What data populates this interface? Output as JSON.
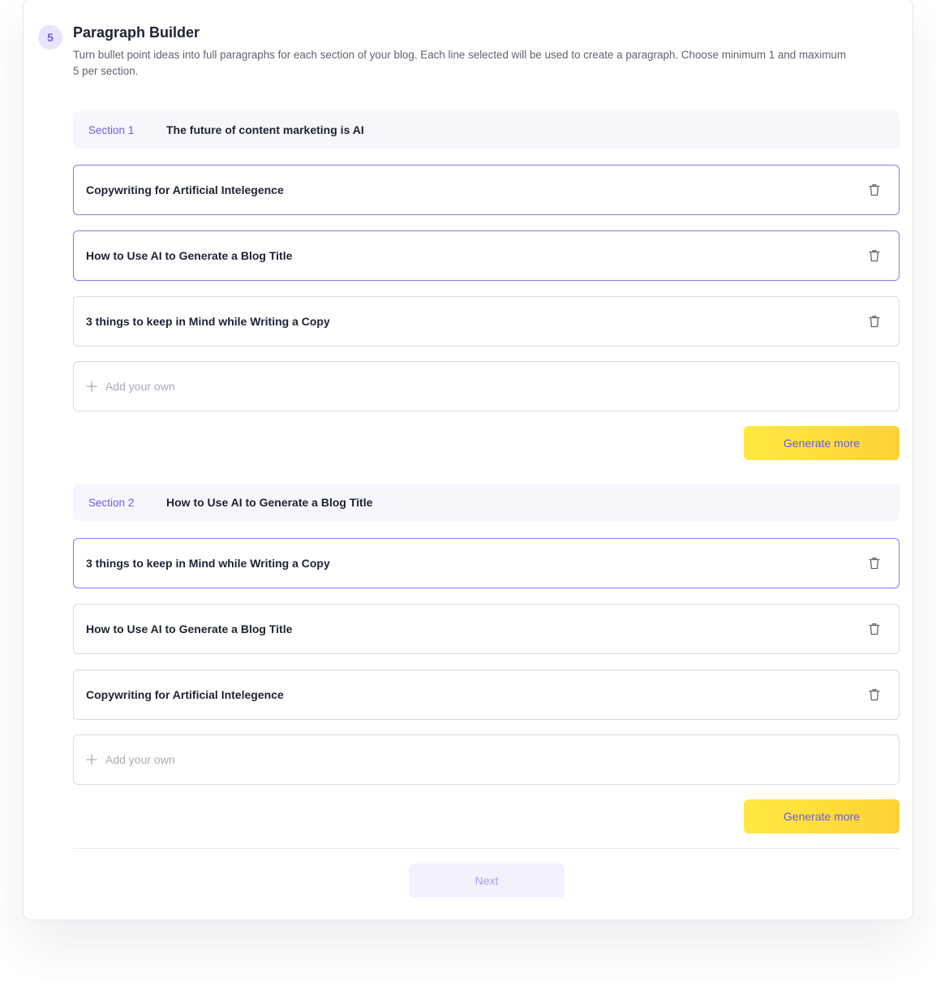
{
  "step": {
    "number": "5",
    "title": "Paragraph Builder",
    "description": "Turn bullet point ideas into full paragraphs for each section of your blog. Each line selected will be used to create a paragraph. Choose minimum 1 and maximum 5 per section."
  },
  "sections": [
    {
      "label": "Section 1",
      "title": "The future of content marketing is AI",
      "items": [
        {
          "text": "Copywriting for Artificial Intelegence",
          "selected": true
        },
        {
          "text": "How to Use AI to Generate a Blog Title",
          "selected": true
        },
        {
          "text": "3 things to keep in Mind while Writing a Copy",
          "selected": false
        }
      ],
      "add_placeholder": "Add your own",
      "generate_label": "Generate more"
    },
    {
      "label": "Section 2",
      "title": "How to Use AI to Generate a Blog Title",
      "items": [
        {
          "text": "3 things to keep in Mind while Writing a Copy",
          "selected": true
        },
        {
          "text": "How to Use AI to Generate a Blog Title",
          "selected": false
        },
        {
          "text": "Copywriting for Artificial Intelegence",
          "selected": false
        }
      ],
      "add_placeholder": "Add your own",
      "generate_label": "Generate more"
    }
  ],
  "footer": {
    "next_label": "Next"
  },
  "colors": {
    "accent": "#6b5ce7",
    "selected_border": "#8c80ef",
    "generate_button": "#fcd234",
    "next_button_bg": "#f2f1fc"
  },
  "icons": {
    "delete": "trash-icon",
    "add": "plus-icon"
  }
}
